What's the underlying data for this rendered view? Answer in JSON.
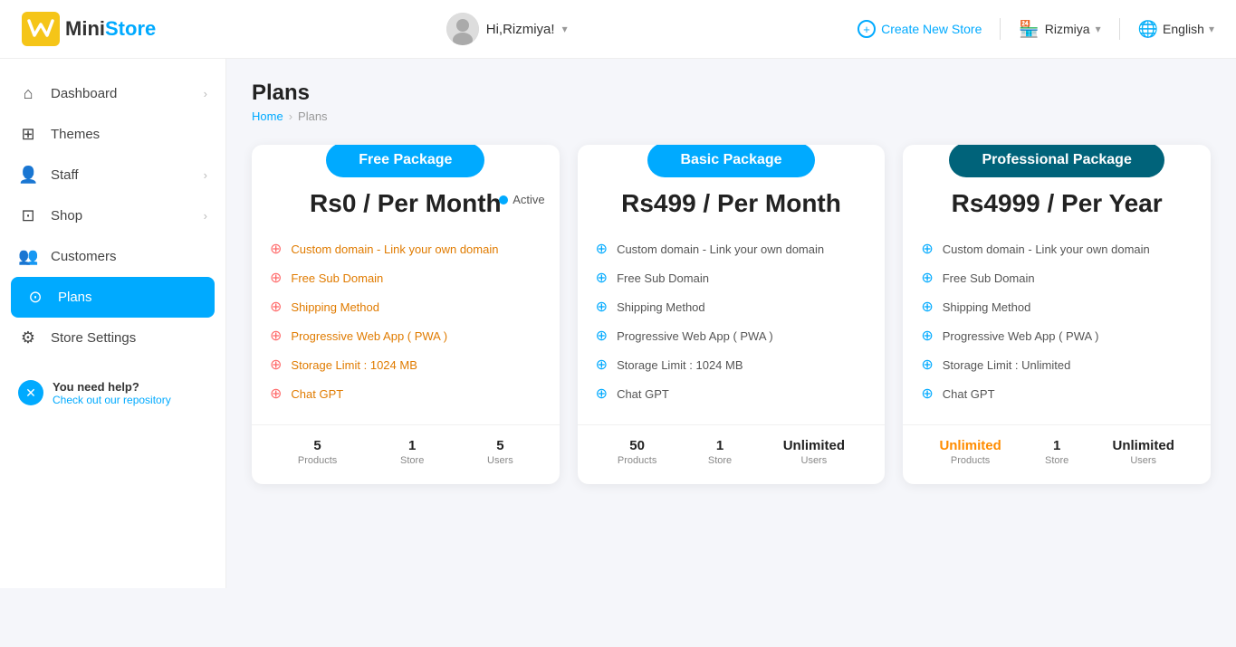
{
  "header": {
    "logo_mini": "Mini",
    "logo_store": "Store",
    "user_greeting": "Hi,Rizmiya!",
    "create_store_label": "Create New Store",
    "store_name": "Rizmiya",
    "language_label": "English"
  },
  "sidebar": {
    "items": [
      {
        "id": "dashboard",
        "label": "Dashboard",
        "icon": "⌂",
        "has_arrow": true
      },
      {
        "id": "themes",
        "label": "Themes",
        "icon": "⊞",
        "has_arrow": false
      },
      {
        "id": "staff",
        "label": "Staff",
        "icon": "👤",
        "has_arrow": true
      },
      {
        "id": "shop",
        "label": "Shop",
        "icon": "⊡",
        "has_arrow": true
      },
      {
        "id": "customers",
        "label": "Customers",
        "icon": "👥",
        "has_arrow": false
      },
      {
        "id": "plans",
        "label": "Plans",
        "icon": "⊙",
        "has_arrow": false,
        "active": true
      },
      {
        "id": "store-settings",
        "label": "Store Settings",
        "icon": "⚙",
        "has_arrow": false
      }
    ],
    "help": {
      "title": "You need help?",
      "subtitle": "Check out our repository"
    }
  },
  "page": {
    "title": "Plans",
    "breadcrumb_home": "Home",
    "breadcrumb_current": "Plans"
  },
  "plans": [
    {
      "id": "free",
      "badge": "Free Package",
      "badge_class": "badge-free",
      "price": "Rs0 / Per Month",
      "is_active": true,
      "active_label": "Active",
      "features": [
        {
          "text": "Custom domain - Link your own domain",
          "color": "orange"
        },
        {
          "text": "Free Sub Domain",
          "color": "orange"
        },
        {
          "text": "Shipping Method",
          "color": "orange"
        },
        {
          "text": "Progressive Web App ( PWA )",
          "color": "orange"
        },
        {
          "text": "Storage Limit : 1024 MB",
          "color": "orange"
        },
        {
          "text": "Chat GPT",
          "color": "orange"
        }
      ],
      "stats": [
        {
          "num": "5",
          "label": "Products",
          "orange": false
        },
        {
          "num": "1",
          "label": "Store",
          "orange": false
        },
        {
          "num": "5",
          "label": "Users",
          "orange": false
        }
      ]
    },
    {
      "id": "basic",
      "badge": "Basic Package",
      "badge_class": "badge-basic",
      "price": "Rs499 / Per Month",
      "is_active": false,
      "features": [
        {
          "text": "Custom domain - Link your own domain",
          "color": "blue"
        },
        {
          "text": "Free Sub Domain",
          "color": "blue"
        },
        {
          "text": "Shipping Method",
          "color": "blue"
        },
        {
          "text": "Progressive Web App ( PWA )",
          "color": "blue"
        },
        {
          "text": "Storage Limit : 1024 MB",
          "color": "blue"
        },
        {
          "text": "Chat GPT",
          "color": "blue"
        }
      ],
      "stats": [
        {
          "num": "50",
          "label": "Products",
          "orange": false
        },
        {
          "num": "1",
          "label": "Store",
          "orange": false
        },
        {
          "num": "Unlimited",
          "label": "Users",
          "orange": false
        }
      ]
    },
    {
      "id": "professional",
      "badge": "Professional Package",
      "badge_class": "badge-pro",
      "price": "Rs4999 / Per Year",
      "is_active": false,
      "features": [
        {
          "text": "Custom domain - Link your own domain",
          "color": "blue"
        },
        {
          "text": "Free Sub Domain",
          "color": "blue"
        },
        {
          "text": "Shipping Method",
          "color": "blue"
        },
        {
          "text": "Progressive Web App ( PWA )",
          "color": "blue"
        },
        {
          "text": "Storage Limit : Unlimited",
          "color": "blue"
        },
        {
          "text": "Chat GPT",
          "color": "blue"
        }
      ],
      "stats": [
        {
          "num": "Unlimited",
          "label": "Products",
          "orange": true
        },
        {
          "num": "1",
          "label": "Store",
          "orange": false
        },
        {
          "num": "Unlimited",
          "label": "Users",
          "orange": false
        }
      ]
    }
  ]
}
